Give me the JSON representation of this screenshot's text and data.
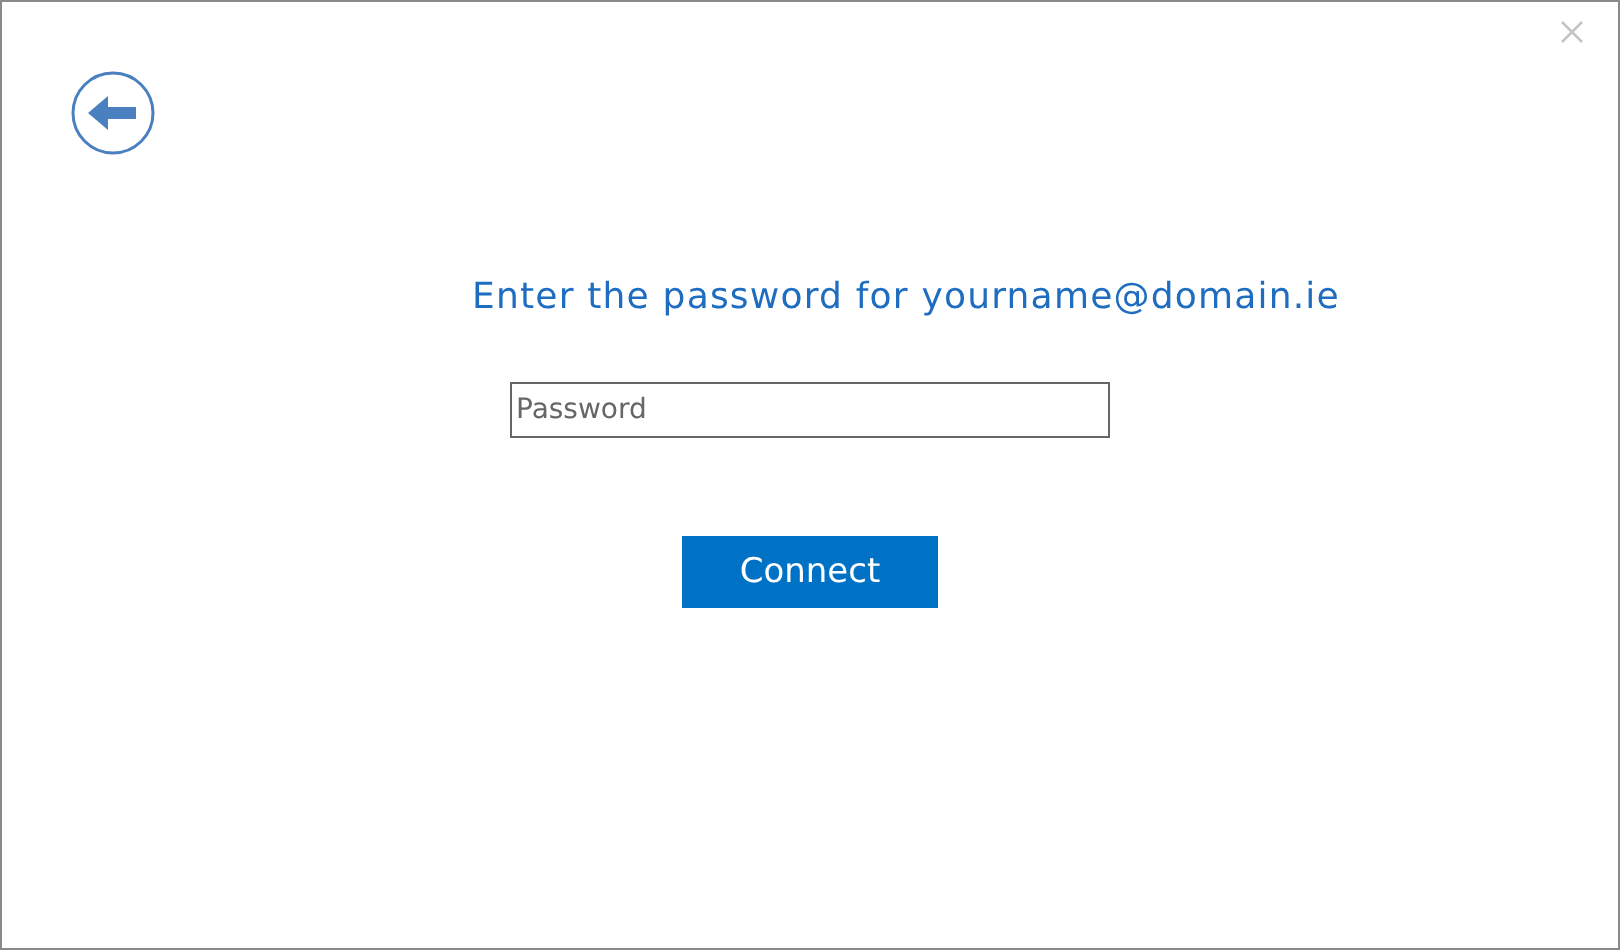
{
  "heading": "Enter the password for yourname@domain.ie",
  "password_field": {
    "placeholder": "Password"
  },
  "buttons": [
    {
      "label": "Connect"
    }
  ]
}
